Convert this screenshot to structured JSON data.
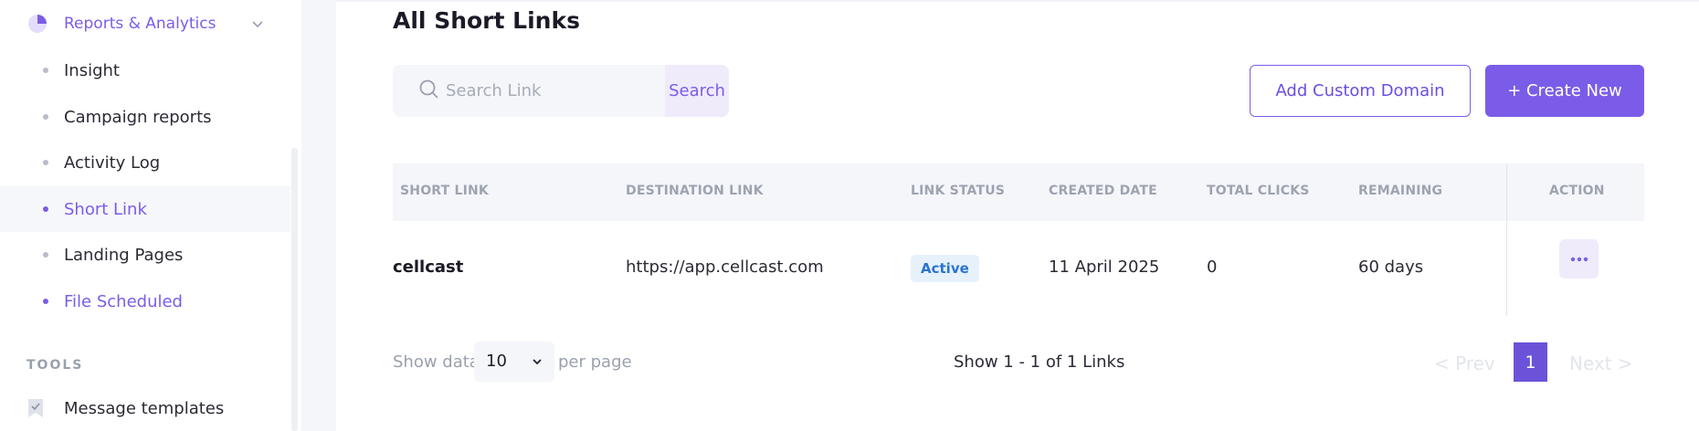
{
  "sidebar": {
    "parent": {
      "label": "Reports & Analytics",
      "icon": "pie-chart-icon"
    },
    "items": [
      {
        "label": "Insight"
      },
      {
        "label": "Campaign reports"
      },
      {
        "label": "Activity Log"
      },
      {
        "label": "Short Link",
        "active": true
      },
      {
        "label": "Landing Pages"
      },
      {
        "label": "File Scheduled"
      }
    ],
    "tools_title": "TOOLS",
    "tools": [
      {
        "label": "Message templates",
        "icon": "bookmark-check-icon"
      }
    ]
  },
  "main": {
    "title": "All Short Links",
    "search": {
      "placeholder": "Search Link",
      "value": "",
      "button_label": "Search"
    },
    "add_domain_label": "Add Custom Domain",
    "create_label": "+ Create New",
    "table": {
      "headers": [
        "SHORT LINK",
        "DESTINATION LINK",
        "LINK STATUS",
        "CREATED DATE",
        "TOTAL CLICKS",
        "REMAINING",
        "ACTION"
      ],
      "rows": [
        {
          "short_link": "cellcast",
          "destination": "https://app.cellcast.com",
          "status": "Active",
          "created": "11 April 2025",
          "clicks": "0",
          "remaining": "60 days",
          "action_label": "..."
        }
      ]
    },
    "pagination": {
      "show_data_label": "Show data",
      "per_page_value": "10",
      "per_page_label": "per page",
      "range_text": "Show 1 - 1 of 1 Links",
      "prev_label": "< Prev",
      "current_page": "1",
      "next_label": "Next >"
    }
  },
  "colors": {
    "accent": "#7b5ce8",
    "active_badge_bg": "#e6f1fb",
    "active_badge_text": "#2a73d0"
  }
}
